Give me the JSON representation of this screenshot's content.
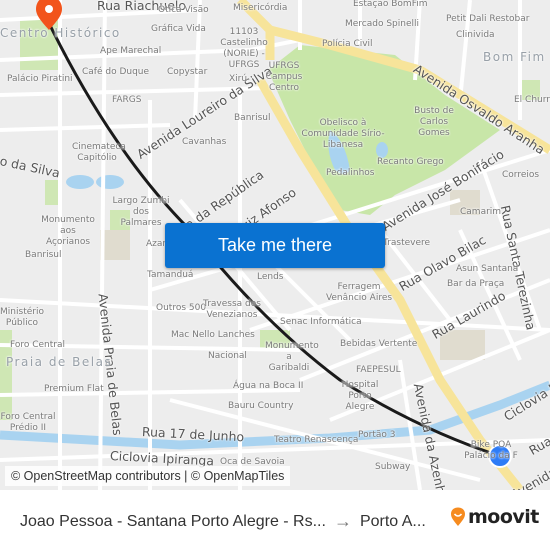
{
  "map": {
    "streets": [
      "Rua Riachuelo",
      "Avenida Loureiro da Silva",
      "o da Silva",
      "Avenida Osvaldo Aranha",
      "Avenida José Bonifácio",
      "ua da República",
      "uiz Afonso",
      "Rua Olavo Bilac",
      "Rua Santa Terezinha",
      "Rua Laurindo",
      "Avenida Praia de Belas",
      "Avenida da Azenha",
      "Rua 17 de Junho",
      "Ciclovia Ipiranga",
      "Ciclovia I",
      "Rua",
      "Avenida"
    ],
    "districts": [
      "Centro Histórico",
      "Bom Fim",
      "Praia de Belas"
    ],
    "places": [
      "Ótica Visão",
      "Misericórdia",
      "Estação BomFim",
      "Gráfica Vida",
      "Mercado Spinelli",
      "Petit Dali Restobar",
      "Clinivida",
      "11103 Castelinho (NORIE) - UFRGS",
      "Polícia Civil",
      "Ape Marechal",
      "Palácio Piratini",
      "Café do Duque",
      "Copystar",
      "Xirú",
      "UFRGS Campus Centro",
      "FARGS",
      "El Churre",
      "Banrisul",
      "Busto de Carlos Gomes",
      "Obelisco à Comunidade Sírio-Libanesa",
      "Cavanhas",
      "Cinemateca Capitólio",
      "Recanto Grego",
      "Pedalinhos",
      "Correios",
      "Largo Zumbi dos Palmares",
      "Monumento aos Açorianos",
      "Camarim",
      "Trastevere",
      "Azan",
      "Tamanduá",
      "Lends",
      "Asun Santana",
      "Bar da Praça",
      "Ferragem Venâncio Aires",
      "Outros 500",
      "Travessa dos Venezianos",
      "Ministério Público",
      "Senac Informática",
      "Mac Nello Lanches",
      "Monumento a Garibaldi",
      "Bebidas Vertente",
      "Foro Central",
      "Nacional",
      "FAEPESUL",
      "Premium Flat",
      "Água na Boca II",
      "Hospital Porto Alegre",
      "Bauru Country",
      "Foro Central Prédio II",
      "Teatro Renascença",
      "Portão 3",
      "Bike POA Palácio da F",
      "Subway",
      "Oca de Savoia",
      "Banrisul"
    ],
    "route": {
      "origin": "Joao Pessoa - Santana Porto Alegre - Rs",
      "destination": "Porto Alegre"
    },
    "markers": {
      "origin_color": "#2e7cf6",
      "destination_color": "#f2541b"
    },
    "cta_label": "Take me there",
    "attribution": "© OpenStreetMap contributors | © OpenMapTiles"
  },
  "footer": {
    "origin_label": "Joao Pessoa - Santana Porto Alegre - Rs...",
    "arrow": "→",
    "destination_label": "Porto A...",
    "brand": "moovit",
    "brand_color": "#f68b1f"
  }
}
